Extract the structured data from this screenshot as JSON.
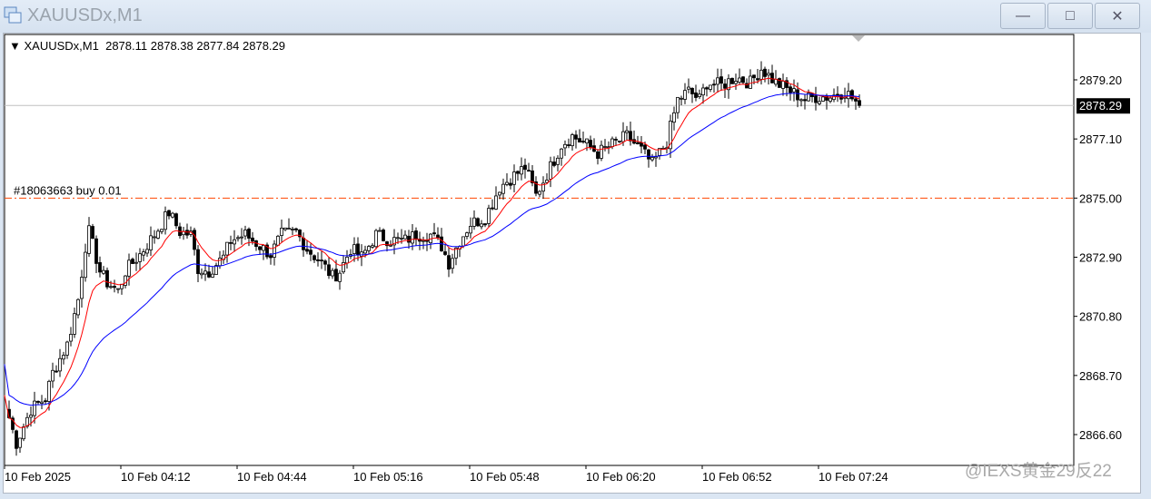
{
  "window": {
    "title": "XAUUSDx,M1",
    "minimize": "—",
    "maximize": "□",
    "close": "✕"
  },
  "info": {
    "symbol": "XAUUSDx,M1",
    "open": "2878.11",
    "high": "2878.38",
    "low": "2877.84",
    "close": "2878.29"
  },
  "order": {
    "label": "#18063663 buy 0.01",
    "price": 2875.0,
    "color": "#ff4500"
  },
  "current_price": {
    "label": "2878.29",
    "value": 2878.29
  },
  "watermark": "@IEXS黄金29反22",
  "chart_data": {
    "type": "candlestick",
    "price_ticks": [
      "2879.20",
      "2877.10",
      "2875.00",
      "2872.90",
      "2870.80",
      "2868.70",
      "2866.60"
    ],
    "ylim": [
      2866.6,
      2879.2
    ],
    "time_ticks": [
      "10 Feb 2025",
      "10 Feb 04:12",
      "10 Feb 04:44",
      "10 Feb 05:16",
      "10 Feb 05:48",
      "10 Feb 06:20",
      "10 Feb 06:52",
      "10 Feb 07:24"
    ],
    "minutes_per_tick": 32,
    "close_anchors_minute_price": [
      [
        0,
        2867.2
      ],
      [
        2,
        2866.3
      ],
      [
        6,
        2867.5
      ],
      [
        10,
        2867.9
      ],
      [
        12,
        2868.8
      ],
      [
        16,
        2869.8
      ],
      [
        19,
        2871.4
      ],
      [
        21,
        2873.3
      ],
      [
        22,
        2873.8
      ],
      [
        25,
        2872.4
      ],
      [
        27,
        2872.0
      ],
      [
        30,
        2871.7
      ],
      [
        32,
        2872.4
      ],
      [
        36,
        2873.0
      ],
      [
        40,
        2873.7
      ],
      [
        44,
        2874.5
      ],
      [
        47,
        2873.8
      ],
      [
        50,
        2873.7
      ],
      [
        52,
        2872.5
      ],
      [
        55,
        2872.4
      ],
      [
        59,
        2872.9
      ],
      [
        61,
        2873.5
      ],
      [
        65,
        2873.7
      ],
      [
        69,
        2873.3
      ],
      [
        72,
        2873.0
      ],
      [
        75,
        2873.7
      ],
      [
        79,
        2873.8
      ],
      [
        82,
        2873.2
      ],
      [
        86,
        2872.7
      ],
      [
        89,
        2872.2
      ],
      [
        91,
        2872.4
      ],
      [
        94,
        2873.2
      ],
      [
        97,
        2872.9
      ],
      [
        101,
        2873.7
      ],
      [
        105,
        2873.5
      ],
      [
        109,
        2873.5
      ],
      [
        112,
        2873.7
      ],
      [
        116,
        2873.7
      ],
      [
        119,
        2873.3
      ],
      [
        121,
        2872.7
      ],
      [
        124,
        2873.5
      ],
      [
        127,
        2874.1
      ],
      [
        131,
        2874.3
      ],
      [
        135,
        2875.4
      ],
      [
        139,
        2875.8
      ],
      [
        142,
        2876.1
      ],
      [
        145,
        2875.1
      ],
      [
        149,
        2876.1
      ],
      [
        152,
        2876.9
      ],
      [
        155,
        2877.2
      ],
      [
        159,
        2876.9
      ],
      [
        162,
        2876.6
      ],
      [
        166,
        2876.9
      ],
      [
        170,
        2877.2
      ],
      [
        174,
        2876.7
      ],
      [
        177,
        2876.2
      ],
      [
        181,
        2877.0
      ],
      [
        184,
        2878.5
      ],
      [
        187,
        2878.8
      ],
      [
        190,
        2878.5
      ],
      [
        192,
        2879.1
      ],
      [
        196,
        2879.0
      ],
      [
        200,
        2879.3
      ],
      [
        204,
        2879.1
      ],
      [
        207,
        2879.6
      ],
      [
        211,
        2879.1
      ],
      [
        215,
        2878.8
      ],
      [
        219,
        2878.5
      ],
      [
        222,
        2878.6
      ],
      [
        226,
        2878.6
      ],
      [
        230,
        2878.8
      ],
      [
        234,
        2878.29
      ]
    ],
    "moving_averages": [
      {
        "name": "fast",
        "color": "#ff0000",
        "period": 10
      },
      {
        "name": "slow",
        "color": "#0000ff",
        "period": 34
      }
    ]
  }
}
